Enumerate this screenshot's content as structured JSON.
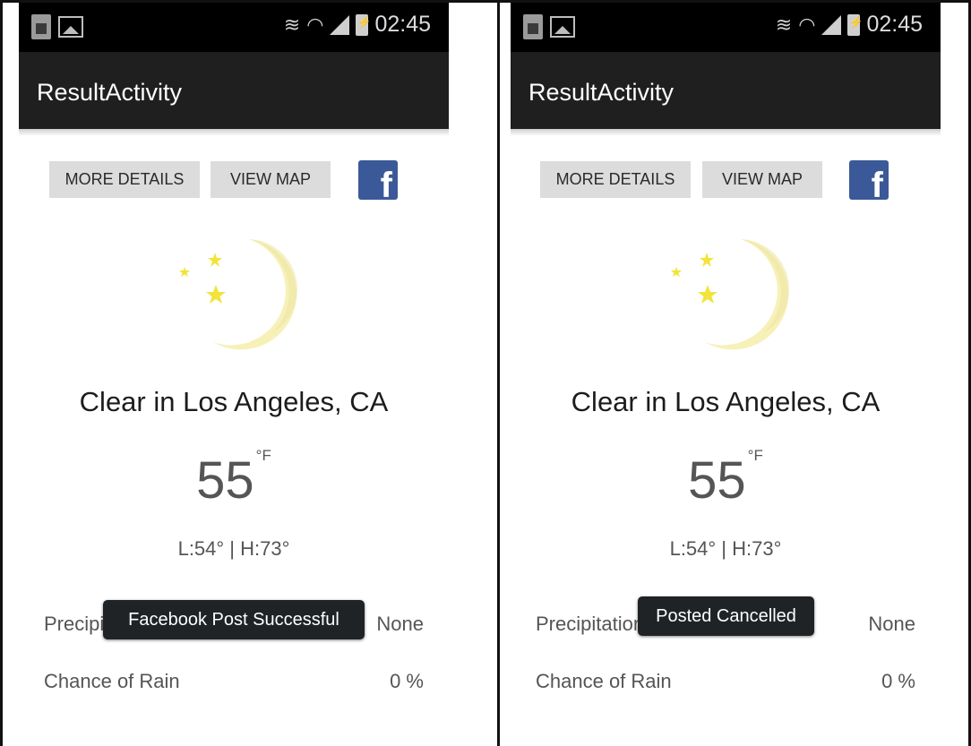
{
  "screens": [
    {
      "status": {
        "time": "02:45"
      },
      "title": "ResultActivity",
      "buttons": {
        "more_details": "MORE DETAILS",
        "view_map": "VIEW MAP",
        "facebook": "f"
      },
      "weather": {
        "summary": "Clear in Los Angeles, CA",
        "temperature": "55",
        "unit": "°F",
        "minmax": "L:54° | H:73°",
        "precip_label": "Precipitation",
        "precip_value": "None",
        "rain_label": "Chance of Rain",
        "rain_value": "0 %"
      },
      "toast": "Facebook Post Successful"
    },
    {
      "status": {
        "time": "02:45"
      },
      "title": "ResultActivity",
      "buttons": {
        "more_details": "MORE DETAILS",
        "view_map": "VIEW MAP",
        "facebook": "f"
      },
      "weather": {
        "summary": "Clear in Los Angeles, CA",
        "temperature": "55",
        "unit": "°F",
        "minmax": "L:54° | H:73°",
        "precip_label": "Precipitation",
        "precip_value": "None",
        "rain_label": "Chance of Rain",
        "rain_value": "0 %"
      },
      "toast": "Posted Cancelled"
    }
  ],
  "colors": {
    "action_bar": "#1f1f1f",
    "facebook_blue": "#3b5998",
    "moon": "#f7f1b8",
    "star": "#f2e43a",
    "toast": "#202326"
  }
}
